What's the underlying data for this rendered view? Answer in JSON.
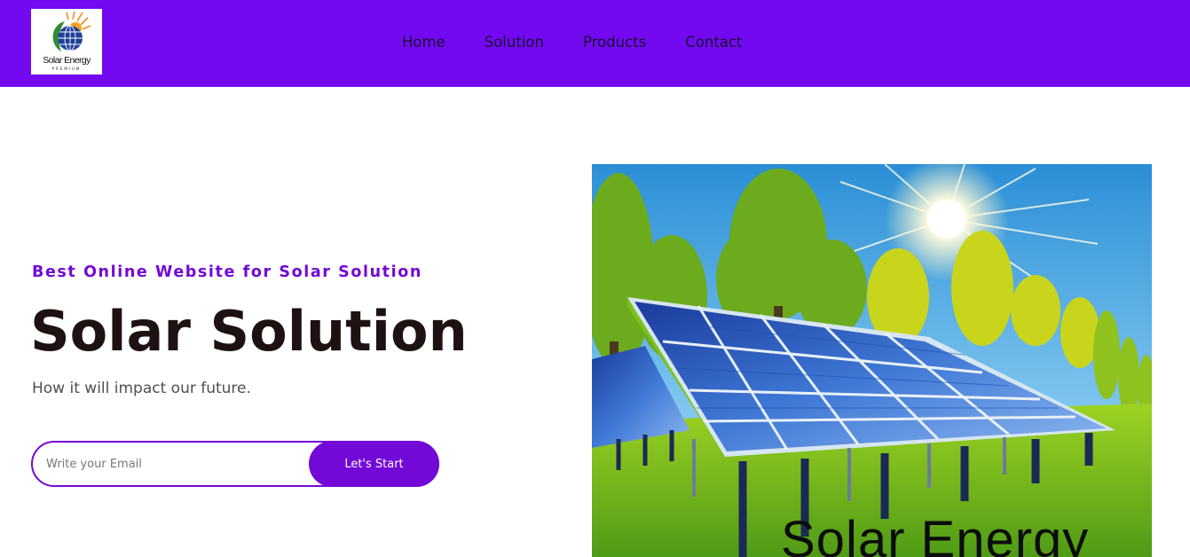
{
  "header": {
    "logo": {
      "text": "Solar Energy",
      "subtext": "PREMIUM",
      "icon": "solar-globe-logo-icon"
    },
    "nav": [
      {
        "label": "Home"
      },
      {
        "label": "Solution"
      },
      {
        "label": "Products"
      },
      {
        "label": "Contact"
      }
    ]
  },
  "hero": {
    "eyebrow": "Best Online Website for Solar Solution",
    "title": "Solar Solution",
    "subtitle": "How it will impact our future.",
    "email_placeholder": "Write your Email",
    "email_value": "",
    "cta_label": "Let's Start",
    "image": {
      "caption": "Solar Energy",
      "description_icon": "solar-panels-illustration"
    }
  },
  "colors": {
    "brand_purple": "#7209f0",
    "accent_purple": "#7209d6",
    "heading_dark": "#1e1111",
    "text_gray": "#4f4f4f"
  }
}
